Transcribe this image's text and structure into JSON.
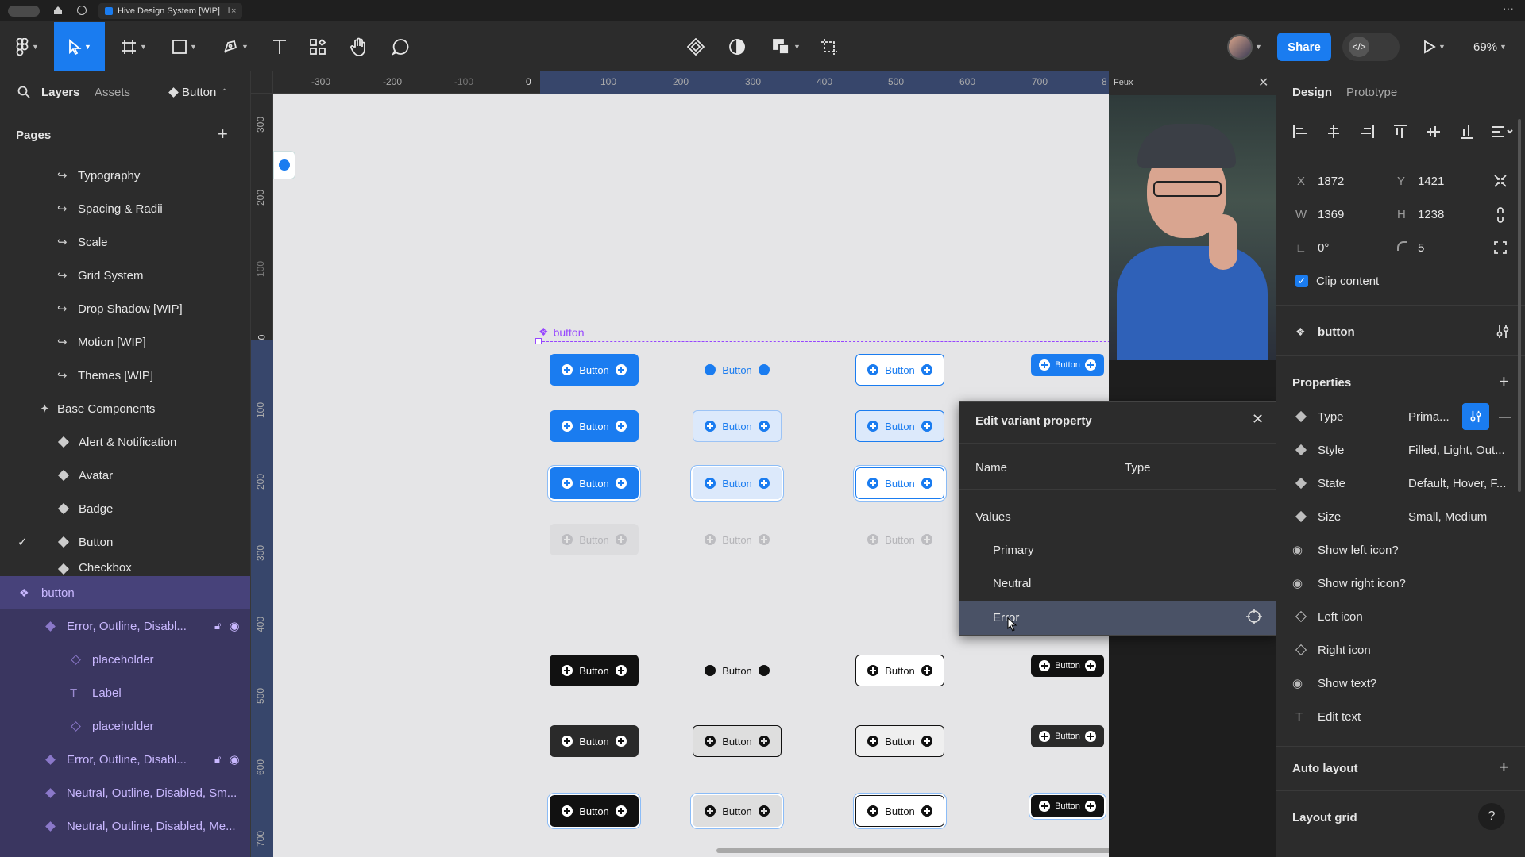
{
  "titlebar": {
    "tab_title": "Hive Design System [WIP]"
  },
  "toolbar": {
    "share_label": "Share",
    "zoom": "69%"
  },
  "left_panel": {
    "tabs": {
      "layers": "Layers",
      "assets": "Assets",
      "component": "Button"
    },
    "pages_title": "Pages",
    "pages": [
      "Typography",
      "Spacing & Radii",
      "Scale",
      "Grid System",
      "Drop Shadow [WIP]",
      "Motion [WIP]",
      "Themes [WIP]"
    ],
    "base_components": "Base Components",
    "components": [
      "Alert & Notification",
      "Avatar",
      "Badge",
      "Button",
      "Checkbox"
    ],
    "layers": {
      "root": "button",
      "items": [
        {
          "label": "Error, Outline, Disabl..."
        },
        {
          "label": "placeholder"
        },
        {
          "label": "Label"
        },
        {
          "label": "placeholder"
        },
        {
          "label": "Error, Outline, Disabl..."
        },
        {
          "label": "Neutral, Outline, Disabled, Sm..."
        },
        {
          "label": "Neutral, Outline, Disabled, Me..."
        }
      ]
    }
  },
  "ruler": {
    "h": [
      "-300",
      "-200",
      "-100",
      "0",
      "100",
      "200",
      "300",
      "400",
      "500",
      "600",
      "700",
      "8"
    ],
    "v": [
      "300",
      "200",
      "100",
      "0",
      "100",
      "200",
      "300",
      "400",
      "500",
      "600",
      "700"
    ]
  },
  "canvas": {
    "frame_label": "button",
    "button_label": "Button"
  },
  "video": {
    "label": "Feux"
  },
  "popup": {
    "title": "Edit variant property",
    "name_label": "Name",
    "type_label": "Type",
    "values_label": "Values",
    "values": [
      "Primary",
      "Neutral",
      "Error"
    ]
  },
  "right_panel": {
    "tabs": {
      "design": "Design",
      "prototype": "Prototype"
    },
    "x_label": "X",
    "x": "1872",
    "y_label": "Y",
    "y": "1421",
    "w_label": "W",
    "w": "1369",
    "h_label": "H",
    "h": "1238",
    "rotation": "0°",
    "radius": "5",
    "clip_content": "Clip content",
    "component_name": "button",
    "properties_title": "Properties",
    "properties": [
      {
        "name": "Type",
        "value": "Prima..."
      },
      {
        "name": "Style",
        "value": "Filled, Light, Out..."
      },
      {
        "name": "State",
        "value": "Default, Hover, F..."
      },
      {
        "name": "Size",
        "value": "Small, Medium"
      },
      {
        "name": "Show left icon?",
        "value": ""
      },
      {
        "name": "Show right icon?",
        "value": ""
      },
      {
        "name": "Left icon",
        "value": ""
      },
      {
        "name": "Right icon",
        "value": ""
      },
      {
        "name": "Show text?",
        "value": ""
      },
      {
        "name": "Edit text",
        "value": ""
      }
    ],
    "auto_layout": "Auto layout",
    "layout_grid": "Layout grid",
    "help": "?"
  },
  "colors": {
    "accent": "#1a7cf0",
    "component_purple": "#9747ff",
    "canvas_bg": "#e5e5e7"
  }
}
